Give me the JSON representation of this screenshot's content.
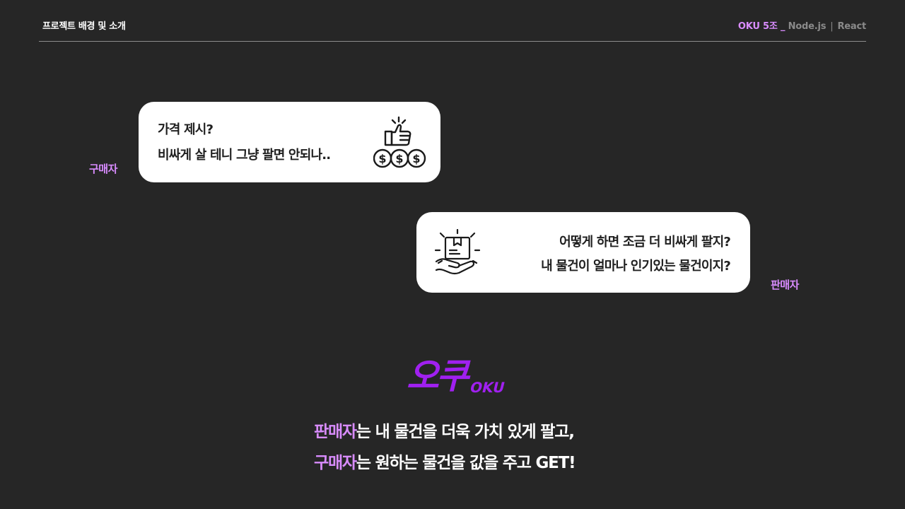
{
  "header": {
    "title": "프로젝트 배경 및 소개",
    "team": "OKU 5조 _",
    "tech_1": "Node.js",
    "tech_2": "React",
    "separator": "|"
  },
  "buyer": {
    "role": "구매자",
    "line_1": "가격 제시?",
    "line_2": "비싸게 살 테니 그냥 팔면 안되나..",
    "icon": "thumbs-up-coins-icon"
  },
  "seller": {
    "role": "판매자",
    "line_1": "어떻게 하면 조금 더 비싸게 팔지?",
    "line_2": "내 물건이 얼마나 인기있는 물건이지?",
    "icon": "hand-holding-box-icon"
  },
  "logo": {
    "main": "오쿠",
    "sub": "OKU"
  },
  "tagline": {
    "line_1_highlight": "판매자",
    "line_1_rest": "는 내 물건을 더욱 가치 있게 팔고,",
    "line_2_highlight": "구매자",
    "line_2_rest": "는 원하는 물건을 값을 주고 GET!"
  },
  "colors": {
    "background": "#262626",
    "accent": "#d98cff",
    "logo": "#a020f0",
    "bubble": "#ffffff"
  }
}
